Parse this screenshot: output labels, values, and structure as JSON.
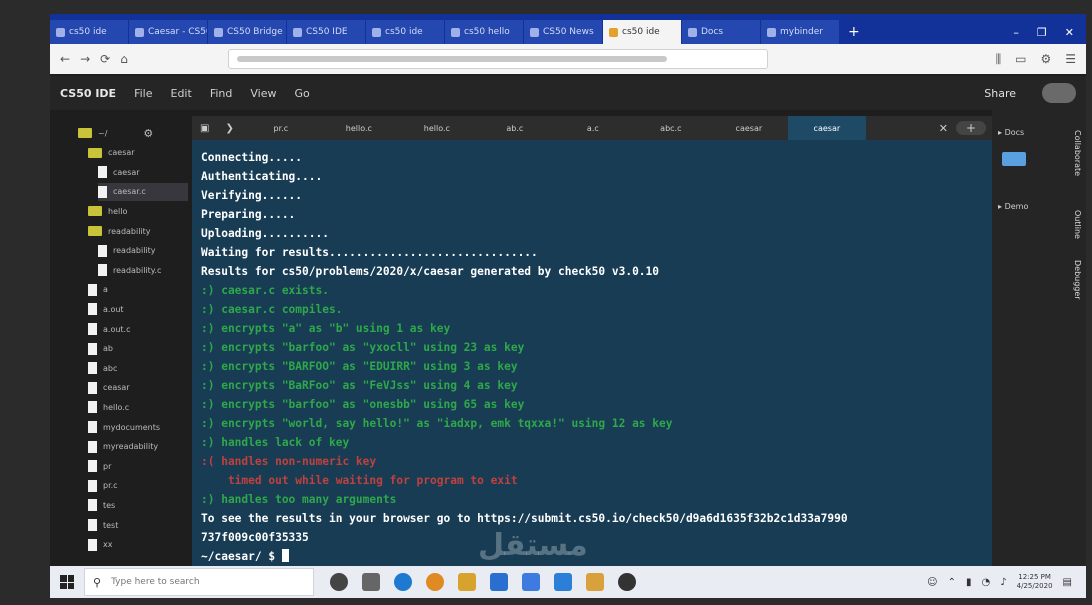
{
  "browser": {
    "tabs": [
      {
        "label": "cs50 ide"
      },
      {
        "label": "Caesar - CS50"
      },
      {
        "label": "CS50 Bridge"
      },
      {
        "label": "CS50 IDE"
      },
      {
        "label": "cs50 ide"
      },
      {
        "label": "cs50 hello"
      },
      {
        "label": "CS50 News"
      },
      {
        "label": "cs50 ide",
        "active": true
      },
      {
        "label": "Docs"
      },
      {
        "label": "mybinder"
      }
    ],
    "new_tab": "+",
    "window_controls": [
      "–",
      "❐",
      "✕"
    ],
    "nav": [
      "←",
      "→",
      "⟳",
      "⌂"
    ]
  },
  "ide": {
    "title": "CS50 IDE",
    "menu": [
      "File",
      "Edit",
      "Find",
      "View",
      "Go"
    ],
    "share": "Share"
  },
  "file_tree": [
    {
      "type": "folder",
      "label": "~/",
      "indent": 0
    },
    {
      "type": "folder",
      "label": "caesar",
      "indent": 1
    },
    {
      "type": "file",
      "label": "caesar",
      "indent": 2
    },
    {
      "type": "file",
      "label": "caesar.c",
      "indent": 2,
      "selected": true
    },
    {
      "type": "folder",
      "label": "hello",
      "indent": 1
    },
    {
      "type": "folder",
      "label": "readability",
      "indent": 1
    },
    {
      "type": "file",
      "label": "readability",
      "indent": 2
    },
    {
      "type": "file",
      "label": "readability.c",
      "indent": 2
    },
    {
      "type": "file",
      "label": "a",
      "indent": 1
    },
    {
      "type": "file",
      "label": "a.out",
      "indent": 1
    },
    {
      "type": "file",
      "label": "a.out.c",
      "indent": 1
    },
    {
      "type": "file",
      "label": "ab",
      "indent": 1
    },
    {
      "type": "file",
      "label": "abc",
      "indent": 1
    },
    {
      "type": "file",
      "label": "ceasar",
      "indent": 1
    },
    {
      "type": "file",
      "label": "hello.c",
      "indent": 1
    },
    {
      "type": "file",
      "label": "mydocuments",
      "indent": 1
    },
    {
      "type": "file",
      "label": "myreadability",
      "indent": 1
    },
    {
      "type": "file",
      "label": "pr",
      "indent": 1
    },
    {
      "type": "file",
      "label": "pr.c",
      "indent": 1
    },
    {
      "type": "file",
      "label": "tes",
      "indent": 1
    },
    {
      "type": "file",
      "label": "test",
      "indent": 1
    },
    {
      "type": "file",
      "label": "xx",
      "indent": 1
    }
  ],
  "terminal": {
    "tabs": [
      "pr.c",
      "hello.c",
      "hello.c",
      "ab.c",
      "a.c",
      "abc.c",
      "caesar",
      "caesar"
    ],
    "lines": [
      {
        "text": "Connecting.....",
        "style": "plain"
      },
      {
        "text": "Authenticating....",
        "style": "plain"
      },
      {
        "text": "Verifying......",
        "style": "plain"
      },
      {
        "text": "Preparing.....",
        "style": "plain"
      },
      {
        "text": "Uploading..........",
        "style": "plain"
      },
      {
        "text": "Waiting for results...............................",
        "style": "plain"
      },
      {
        "text": "Results for cs50/problems/2020/x/caesar generated by check50 v3.0.10",
        "style": "plain"
      },
      {
        "text": ":) caesar.c exists.",
        "style": "green"
      },
      {
        "text": ":) caesar.c compiles.",
        "style": "green"
      },
      {
        "text": ":) encrypts \"a\" as \"b\" using 1 as key",
        "style": "green"
      },
      {
        "text": ":) encrypts \"barfoo\" as \"yxocll\" using 23 as key",
        "style": "green"
      },
      {
        "text": ":) encrypts \"BARFOO\" as \"EDUIRR\" using 3 as key",
        "style": "green"
      },
      {
        "text": ":) encrypts \"BaRFoo\" as \"FeVJss\" using 4 as key",
        "style": "green"
      },
      {
        "text": ":) encrypts \"barfoo\" as \"onesbb\" using 65 as key",
        "style": "green"
      },
      {
        "text": ":) encrypts \"world, say hello!\" as \"iadxp, emk tqxxa!\" using 12 as key",
        "style": "green"
      },
      {
        "text": ":) handles lack of key",
        "style": "green"
      },
      {
        "text": ":( handles non-numeric key",
        "style": "red"
      },
      {
        "text": "    timed out while waiting for program to exit",
        "style": "red"
      },
      {
        "text": ":) handles too many arguments",
        "style": "green"
      },
      {
        "text": "To see the results in your browser go to https://submit.cs50.io/check50/d9a6d1635f32b2c1d33a7990",
        "style": "plain"
      },
      {
        "text": "737f009c00f35335",
        "style": "plain"
      }
    ],
    "prompt": "~/caesar/ $ "
  },
  "right_panel": {
    "sections": [
      "Docs",
      "Demo"
    ],
    "vertical_tabs": [
      "Collaborate",
      "Outline",
      "Debugger"
    ]
  },
  "taskbar": {
    "search_placeholder": "Type here to search",
    "clock": [
      "12:25 PM",
      "4/25/2020"
    ]
  },
  "watermark": "مستقل"
}
